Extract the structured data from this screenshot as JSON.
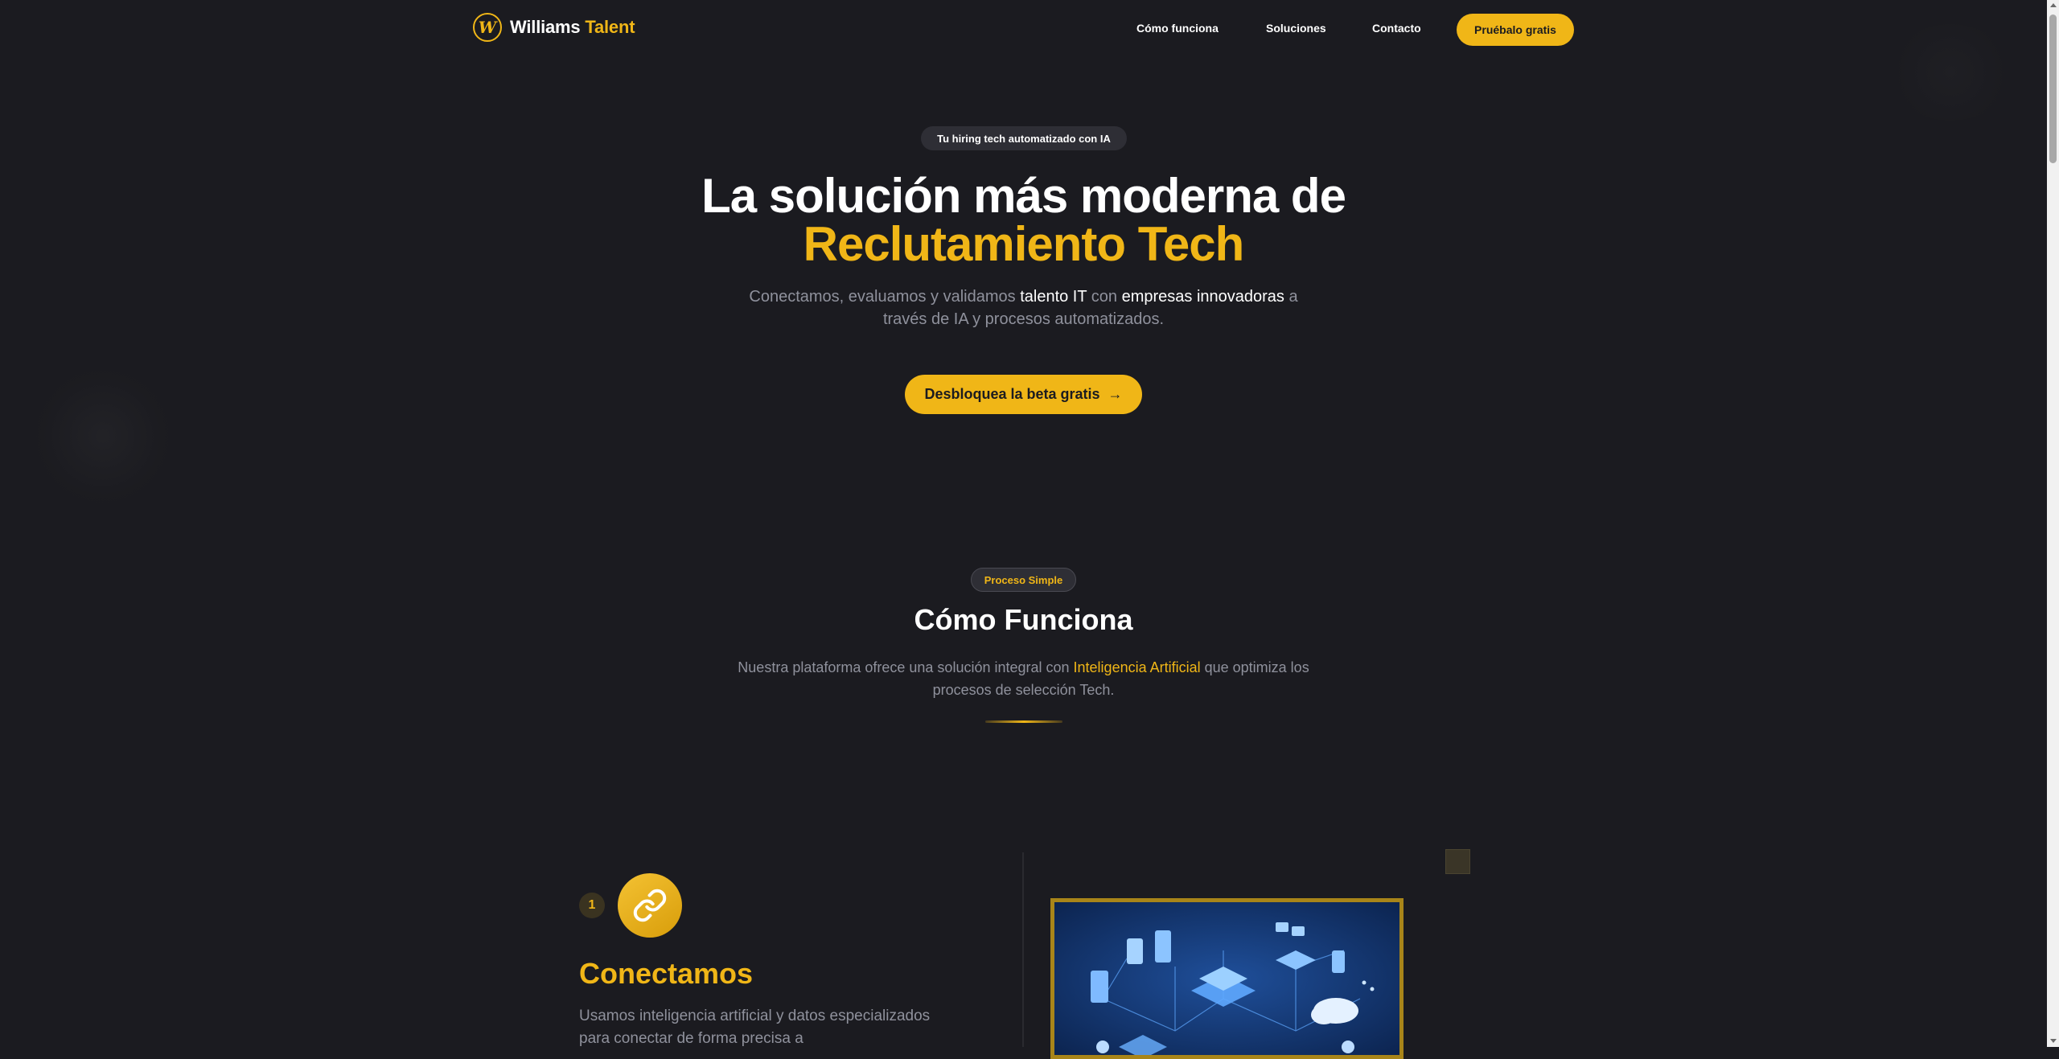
{
  "brand": {
    "name_main": "Williams",
    "name_accent": "Talent",
    "logo_letter": "W"
  },
  "nav": {
    "links": [
      "Cómo funciona",
      "Soluciones",
      "Contacto"
    ],
    "cta": "Pruébalo gratis"
  },
  "hero": {
    "badge": "Tu hiring tech automatizado con IA",
    "title_line1": "La solución más moderna de",
    "title_line2": "Reclutamiento Tech",
    "subtitle_a": "Conectamos, evaluamos y validamos ",
    "subtitle_hl1": "talento IT",
    "subtitle_b": " con ",
    "subtitle_hl2": "empresas innovadoras",
    "subtitle_c": " a través de IA y procesos automatizados.",
    "cta": "Desbloquea la beta gratis",
    "cta_arrow": "→"
  },
  "how_it_works": {
    "badge": "Proceso Simple",
    "title": "Cómo Funciona",
    "subtitle_a": "Nuestra plataforma ofrece una solución integral con ",
    "subtitle_hl": "Inteligencia Artificial",
    "subtitle_b": " que optimiza los procesos de selección Tech."
  },
  "steps": [
    {
      "number": "1",
      "icon": "link-icon",
      "title": "Conectamos",
      "description": "Usamos inteligencia artificial y datos especializados para conectar de forma precisa a"
    }
  ],
  "colors": {
    "background": "#1b1b20",
    "accent": "#f0b617",
    "muted_text": "#8f919c",
    "pill_bg": "#2e2e35"
  }
}
